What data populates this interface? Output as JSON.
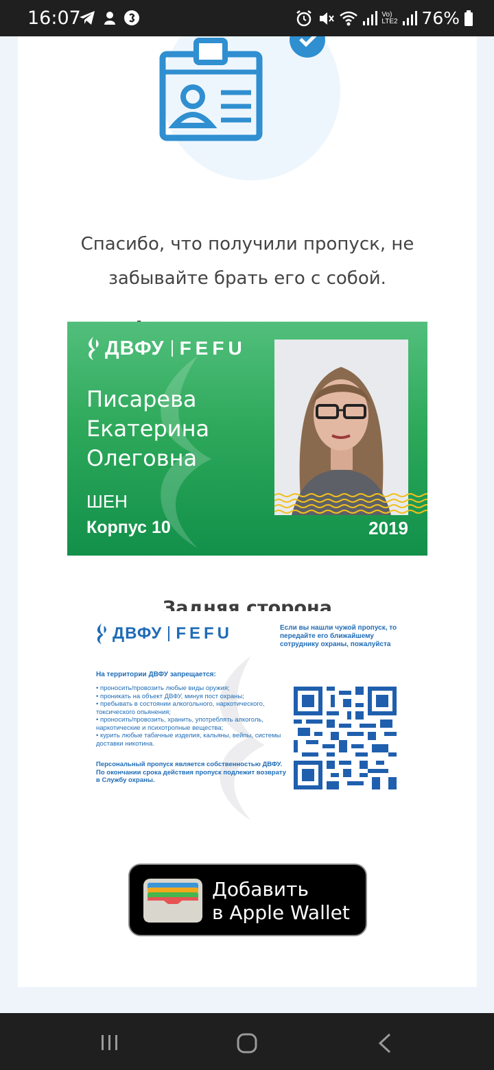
{
  "status_bar": {
    "time": "16:07",
    "battery": "76%",
    "network_label": "Vo) LTE2",
    "icons": [
      "telegram-icon",
      "koala-app-icon",
      "shazam-icon",
      "alarm-icon",
      "mute-icon",
      "wifi-icon",
      "signal-icon",
      "battery-icon"
    ]
  },
  "message": {
    "line1": "Спасибо, что получили пропуск, не",
    "line2": "забывайте брать его с собой."
  },
  "front": {
    "title": "Фронтальная сторона",
    "logo_ru": "ДВФУ",
    "logo_en": "FEFU",
    "name_last": "Писарева",
    "name_first": "Екатерина",
    "name_middle": "Олеговна",
    "school": "ШЕН",
    "building": "Корпус 10",
    "year": "2019"
  },
  "back": {
    "title": "Задняя сторона",
    "logo_ru": "ДВФУ",
    "logo_en": "FEFU",
    "found_notice": "Если вы нашли чужой пропуск, то передайте его ближайшему сотруднику охраны, пожалуйста",
    "rules_title": "На территории ДВФУ запрещается:",
    "rules": [
      "• проносить/провозить любые виды оружия;",
      "• проникать на объект ДВФУ, минуя пост охраны;",
      "• пребывать в состоянии алкогольного, наркотического, токсического опьянения;",
      "• проносить/провозить, хранить, употреблять алкоголь, наркотические и психотропные вещества;",
      "• курить любые табачные изделия, кальяны, вейпы, системы доставки никотина."
    ],
    "ownership": "Персональный пропуск является собственностью ДВФУ. По окончании срока действия пропуск подлежит возврату в Службу охраны."
  },
  "wallet": {
    "line1": "Добавить",
    "line2": "в Apple Wallet"
  },
  "colors": {
    "brand_blue": "#1f6cb6",
    "card_green": "#2ea95b",
    "badge_blue": "#2f8fd0"
  }
}
